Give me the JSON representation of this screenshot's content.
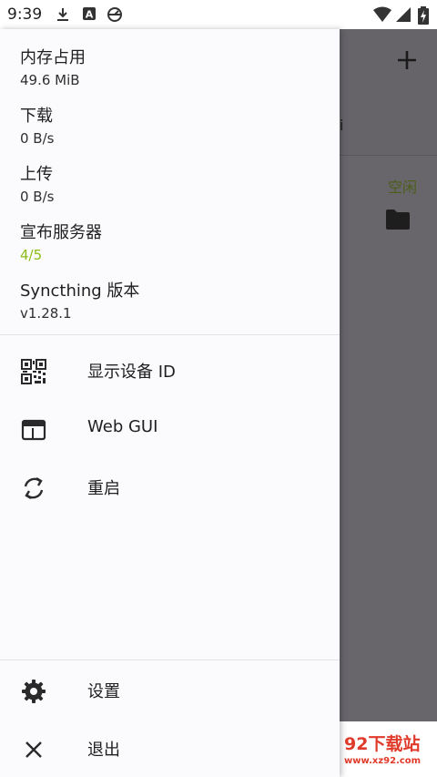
{
  "status_bar": {
    "time": "9:39",
    "icons": [
      "download-icon",
      "font-a-icon",
      "sync-icon",
      "wifi-icon",
      "signal-icon",
      "battery-charging-icon"
    ]
  },
  "background_app": {
    "add_icon": "plus-icon",
    "partial_text": "i",
    "folder_status": "空闲",
    "folder_icon": "folder-icon"
  },
  "drawer": {
    "stats": [
      {
        "label": "内存占用",
        "value": "49.6 MiB"
      },
      {
        "label": "下载",
        "value": "0 B/s"
      },
      {
        "label": "上传",
        "value": "0 B/s"
      },
      {
        "label": "宣布服务器",
        "value": "4/5",
        "value_color": "#8cbd12"
      },
      {
        "label": "Syncthing 版本",
        "value": "v1.28.1"
      }
    ],
    "menu": [
      {
        "label": "显示设备 ID",
        "icon": "qr-code-icon"
      },
      {
        "label": "Web GUI",
        "icon": "browser-window-icon"
      },
      {
        "label": "重启",
        "icon": "restart-icon"
      }
    ],
    "footer_menu": [
      {
        "label": "设置",
        "icon": "settings-gear-icon"
      },
      {
        "label": "退出",
        "icon": "close-icon"
      }
    ]
  },
  "watermark": {
    "title": "92下载站",
    "url": "www.xz92.com"
  }
}
